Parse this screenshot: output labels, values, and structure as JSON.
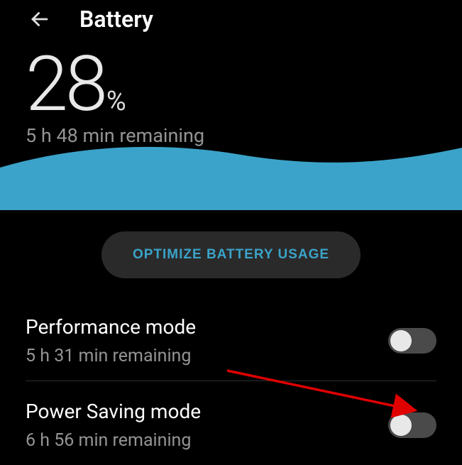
{
  "header": {
    "title": "Battery"
  },
  "hero": {
    "percent": "28",
    "percent_symbol": "%",
    "remaining": "5 h 48 min remaining"
  },
  "optimize": {
    "label": "OPTIMIZE BATTERY USAGE"
  },
  "modes": {
    "performance": {
      "title": "Performance mode",
      "sub": "5 h 31 min remaining",
      "on": false
    },
    "powersaving": {
      "title": "Power Saving mode",
      "sub": "6 h 56 min remaining",
      "on": false
    }
  },
  "colors": {
    "wave": "#3ba3c9",
    "accent": "#3ba3c9",
    "arrow": "#e00000"
  }
}
